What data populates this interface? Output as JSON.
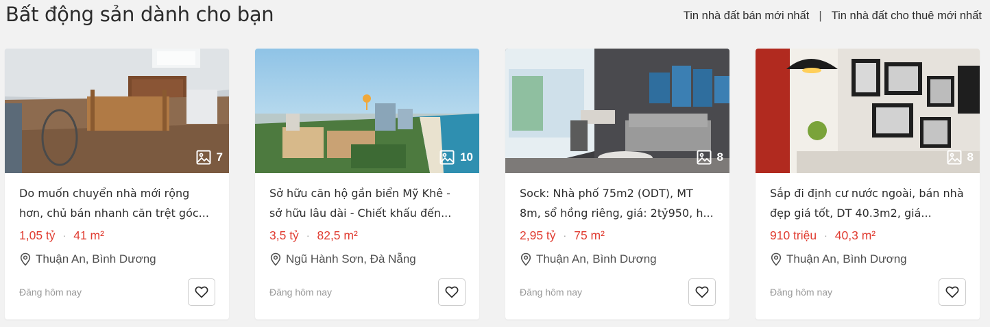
{
  "section": {
    "title": "Bất động sản dành cho bạn",
    "links": [
      {
        "label": "Tin nhà đất bán mới nhất"
      },
      {
        "label": "Tin nhà đất cho thuê mới nhất"
      }
    ],
    "separator": "|"
  },
  "cards": [
    {
      "title": "Do muốn chuyển nhà mới rộng hơn, chủ bán nhanh căn trệt góc...",
      "price": "1,05 tỷ",
      "area": "41 m²",
      "location": "Thuận An, Bình Dương",
      "posted": "Đăng hôm nay",
      "photo_count": "7",
      "image": "room-interior"
    },
    {
      "title": "Sở hữu căn hộ gần biển Mỹ Khê - sở hữu lâu dài - Chiết khấu đến...",
      "price": "3,5 tỷ",
      "area": "82,5 m²",
      "location": "Ngũ Hành Sơn, Đà Nẵng",
      "posted": "Đăng hôm nay",
      "photo_count": "10",
      "image": "coastal-city-aerial"
    },
    {
      "title": "Sock: Nhà phố 75m2 (ODT), MT 8m, sổ hồng riêng, giá: 2tỷ950, h...",
      "price": "2,95 tỷ",
      "area": "75 m²",
      "location": "Thuận An, Bình Dương",
      "posted": "Đăng hôm nay",
      "photo_count": "8",
      "image": "living-room"
    },
    {
      "title": "Sắp đi định cư nước ngoài, bán nhà đẹp giá tốt, DT 40.3m2, giá...",
      "price": "910 triệu",
      "area": "40,3 m²",
      "location": "Thuận An, Bình Dương",
      "posted": "Đăng hôm nay",
      "photo_count": "8",
      "image": "decorated-wall"
    }
  ],
  "colors": {
    "price": "#e03c31",
    "text": "#2c2c2c",
    "muted": "#999999",
    "background": "#f2f2f2"
  }
}
